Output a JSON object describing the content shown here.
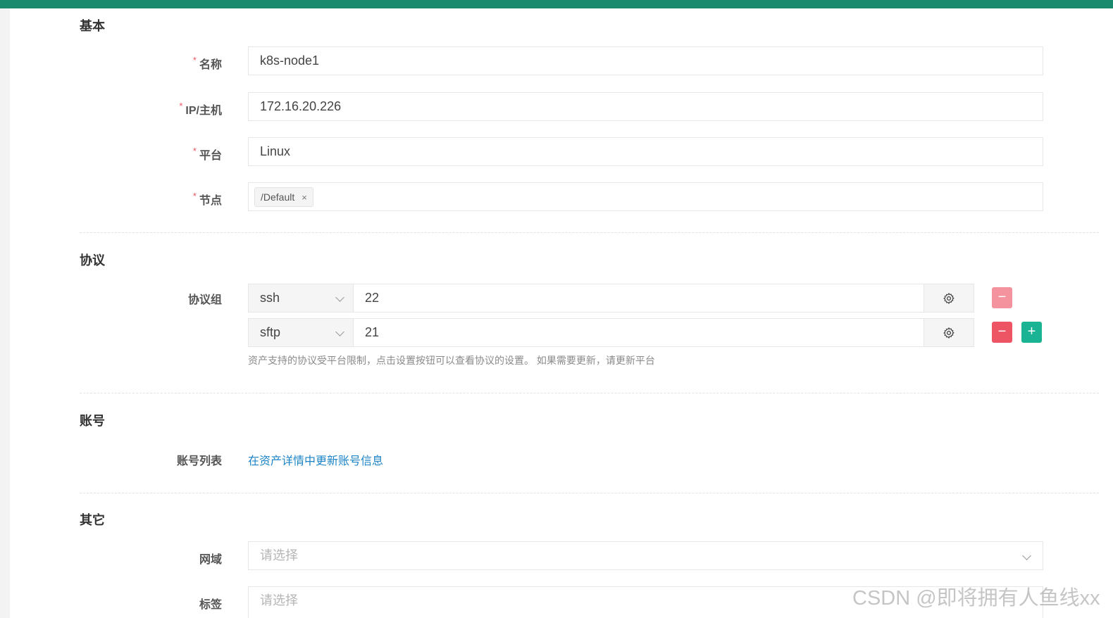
{
  "sections": {
    "basic": "基本",
    "protocol": "协议",
    "account": "账号",
    "other": "其它"
  },
  "fields": {
    "name_label": "名称",
    "name_value": "k8s-node1",
    "ip_label": "IP/主机",
    "ip_value": "172.16.20.226",
    "platform_label": "平台",
    "platform_value": "Linux",
    "node_label": "节点",
    "node_tag": "/Default",
    "required_mark": "*"
  },
  "protocols": {
    "group_label": "协议组",
    "rows": [
      {
        "name": "ssh",
        "port": "22"
      },
      {
        "name": "sftp",
        "port": "21"
      }
    ],
    "help": "资产支持的协议受平台限制，点击设置按钮可以查看协议的设置。 如果需要更新，请更新平台"
  },
  "account": {
    "list_label": "账号列表",
    "link": "在资产详情中更新账号信息"
  },
  "other": {
    "domain_label": "网域",
    "domain_placeholder": "请选择",
    "tags_label": "标签",
    "tags_placeholder": "请选择"
  },
  "icons": {
    "tag_close": "×",
    "minus": "−",
    "plus": "+"
  },
  "colors": {
    "topbar": "#1a8a6f",
    "required": "#ed5565",
    "danger": "#ed5565",
    "danger_light": "#f4939e",
    "primary": "#1ab394",
    "link": "#1c84c6"
  },
  "watermark": "CSDN @即将拥有人鱼线xx"
}
